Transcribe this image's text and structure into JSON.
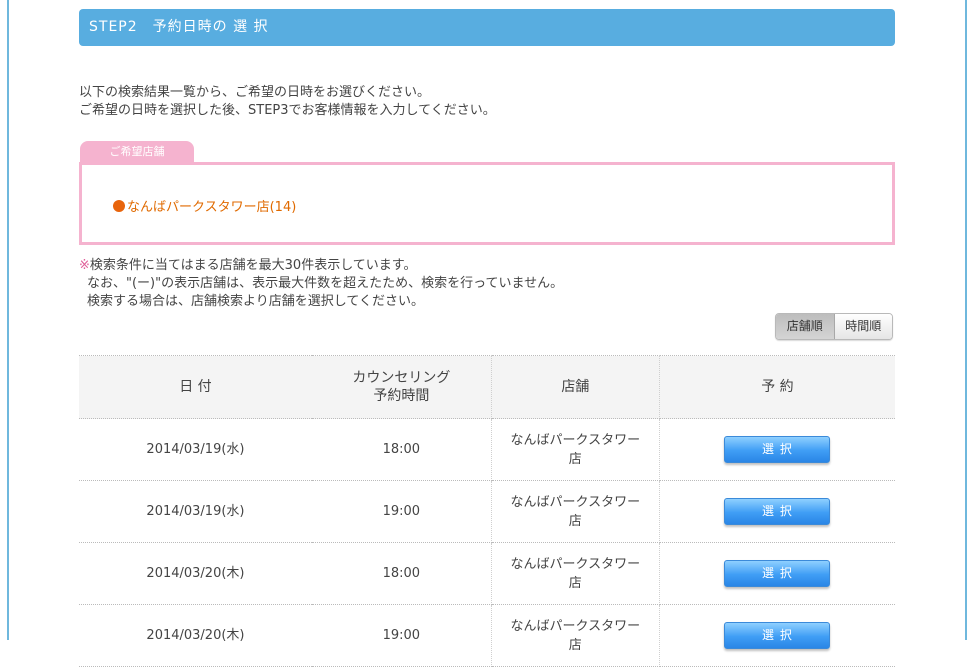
{
  "step": {
    "title": "STEP2　予約日時の 選 択"
  },
  "intro": {
    "line1": "以下の検索結果一覧から、ご希望の日時をお選びください。",
    "line2": "ご希望の日時を選択した後、STEP3でお客様情報を入力してください。"
  },
  "store_panel": {
    "tab_label": "ご希望店舗",
    "store_link": "なんばパークスタワー店(14)"
  },
  "notes": {
    "mark": "※",
    "line1": "検索条件に当てはまる店舗を最大30件表示しています。",
    "line2": "なお、\"(ー)\"の表示店舗は、表示最大件数を超えたため、検索を行っていません。",
    "line3": "検索する場合は、店舗検索より店舗を選択してください。"
  },
  "sort": {
    "by_store": "店舗順",
    "by_time": "時間順",
    "active": "by_store"
  },
  "table": {
    "headers": {
      "date": "日 付",
      "time_line1": "カウンセリング",
      "time_line2": "予約時間",
      "store": "店舗",
      "book": "予 約"
    },
    "rows": [
      {
        "date": "2014/03/19(水)",
        "time": "18:00",
        "store": "なんばパークスタワー店",
        "button": "選 択"
      },
      {
        "date": "2014/03/19(水)",
        "time": "19:00",
        "store": "なんばパークスタワー店",
        "button": "選 択"
      },
      {
        "date": "2014/03/20(木)",
        "time": "18:00",
        "store": "なんばパークスタワー店",
        "button": "選 択"
      },
      {
        "date": "2014/03/20(木)",
        "time": "19:00",
        "store": "なんばパークスタワー店",
        "button": "選 択"
      }
    ]
  },
  "colors": {
    "header_blue": "#58ade0",
    "pink": "#f5b3cf",
    "store_link_orange": "#e06a00",
    "button_blue": "#3f9df5"
  }
}
